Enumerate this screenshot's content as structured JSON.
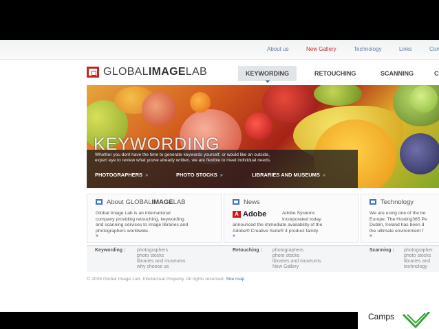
{
  "topnav": {
    "items": [
      "About us",
      "New Gallery",
      "Technology",
      "Links",
      "Con"
    ],
    "active": "New Gallery"
  },
  "logo": {
    "light": "GLOBAL",
    "bold": "IMAGE",
    "tail": "LAB"
  },
  "mainnav": {
    "items": [
      "KEYWORDING",
      "RETOUCHING",
      "SCANNING",
      "CO"
    ],
    "active": "KEYWORDING"
  },
  "hero": {
    "title": "KEYWORDING",
    "copy": "Whether you dont have the time to generate keywords yourself, or would like an outside, expert eye to review what youve already written, we are flexible to meet individual needs.",
    "links": [
      "PHOTOGRAPHERS",
      "PHOTO STOCKS",
      "LIBRARIES AND MUSEUMS"
    ],
    "link_arrow": "»"
  },
  "boxes": {
    "about": {
      "title_light": "About GLOBAL",
      "title_bold": "IMAGE",
      "title_tail": "LAB",
      "lines": [
        "Global Image Lab is an international",
        "company providing retouching, keywording",
        "and scanning services to image libraries and",
        "photographers worldwide."
      ],
      "more": "»"
    },
    "news": {
      "title": "News",
      "adobe_label": "Adobe",
      "adobe_mark": "A",
      "lines_right": [
        "Adobe Systems",
        "Incorporated today"
      ],
      "lines": [
        "announced the immediate availability of the",
        "Adobe® Creative Suite® 4 product family."
      ],
      "more": "»"
    },
    "technology": {
      "title": "Technology",
      "lines": [
        "We are using one of the be",
        "Europe. The Hosting365 Pe",
        "Dublin, Ireland has been d",
        "the ultimate environment f"
      ],
      "more": "»"
    }
  },
  "sitemap": [
    {
      "label": "Keywording :",
      "items": [
        "photographers",
        "photo stocks",
        "libraries and museums",
        "why choose us"
      ]
    },
    {
      "label": "Retouching :",
      "items": [
        "photographers",
        "photo stocks",
        "libraries and museums",
        "New Gallery"
      ]
    },
    {
      "label": "Scanning :",
      "items": [
        "photographer",
        "photo stocks",
        "libraries and",
        "technology"
      ]
    }
  ],
  "footer": {
    "text": "© 2008 Global Image Lab. Intellectual Property. All rights reserved.",
    "link": "Site map"
  },
  "overlay": {
    "camps_text": "Camps"
  },
  "colors": {
    "accent_red": "#c82323",
    "link_blue": "#3a72c4",
    "nav_active_red": "#d02a2a"
  }
}
